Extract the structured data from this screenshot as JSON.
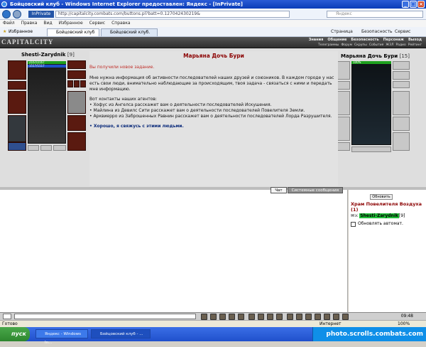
{
  "window": {
    "title": "Бойцовский клуб - Windows Internet Explorer предоставлен: Яндекс - [InPrivate]"
  },
  "address": {
    "inprivate": "InPrivate",
    "url": "http://capitalcity.combats.com/buttons.pl?batt=0.127042430219&",
    "search_placeholder": "Яндекс"
  },
  "menu": [
    "Файл",
    "Правка",
    "Вид",
    "Избранное",
    "Сервис",
    "Справка"
  ],
  "fav": {
    "label": "Избранное",
    "tabs": [
      "Бойцовский клуб",
      "Бойцовский клуб."
    ],
    "right": [
      "Страница",
      "Безопасность",
      "Сервис"
    ]
  },
  "game": {
    "logo": "CAPITALCITY",
    "menu": [
      "Знания",
      "Общение",
      "Безопасность",
      "Персонаж",
      "Выход"
    ],
    "submenu": [
      "Телеграммы",
      "Форум",
      "Скрупы",
      "События",
      "ЖЗЛ",
      "Радио",
      "Рейтинг"
    ]
  },
  "left_char": {
    "name": "Shesti-Zarydnik",
    "level": "[9]",
    "hp": "2167/2167",
    "mp": "1517/1517"
  },
  "right_char": {
    "name": "Марьяна Дочь Бури",
    "level": "[15]",
    "hp": "100%"
  },
  "dialog": {
    "title": "Марьяна Дочь Бури",
    "subtitle": "Вы получили новое задание.",
    "text": "Мне нужна информация об активности последователей наших друзей и союзников. В каждом городе у нас есть свои люди, внимательно наблюдающие за происходящим, твоя задача - связаться с ними и передать мне информацию.",
    "contacts_title": "Вот контакты наших агентов:",
    "contacts": [
      "• Хофус из Ангелса расскажет вам о деятельности последователей Искушения.",
      "• Майлина из Девилс Сити расскажет вам о деятельности последователей Повелителя Земли.",
      "• Арквиерро из Заброшенных Равнин расскажет вам о деятельности последователей Лорда Разрушителя."
    ],
    "answer": "• Хорошо, я свяжусь с этими людьми."
  },
  "chat": {
    "tabs": [
      "Чат",
      "Системные сообщения"
    ]
  },
  "rpanel": {
    "refresh": "Обновить",
    "location": "Храм Повелителя Воздуха (1)",
    "player": "Shesti-Zarydnik",
    "player_level": "[9]",
    "auto": "Обновлять автомат."
  },
  "bottom": {
    "clock": "09:48"
  },
  "status": {
    "left": "Готово",
    "zone": "Интернет",
    "zoom": "100%"
  },
  "taskbar": {
    "start": "пуск",
    "tasks": [
      "Яндекс - Windows In...",
      "Бойцовский клуб - ..."
    ],
    "watermark": "photo.scrolls.combats.com"
  }
}
